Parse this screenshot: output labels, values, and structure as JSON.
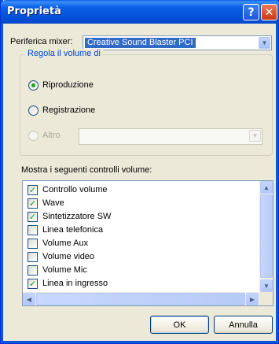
{
  "window": {
    "title": "Proprietà",
    "help_label": "?",
    "close_label": "✕"
  },
  "mixer": {
    "label": "Periferica mixer:",
    "selected": "Creative Sound Blaster PCI"
  },
  "volume_group": {
    "title": "Regola il volume di",
    "options": [
      {
        "label": "Riproduzione",
        "checked": true,
        "enabled": true
      },
      {
        "label": "Registrazione",
        "checked": false,
        "enabled": true
      },
      {
        "label": "Altro",
        "checked": false,
        "enabled": false
      }
    ],
    "altro_select_value": ""
  },
  "controls": {
    "label": "Mostra i seguenti controlli volume:",
    "items": [
      {
        "label": "Controllo volume",
        "checked": true
      },
      {
        "label": "Wave",
        "checked": true
      },
      {
        "label": "Sintetizzatore SW",
        "checked": true
      },
      {
        "label": "Linea telefonica",
        "checked": false
      },
      {
        "label": "Volume Aux",
        "checked": false
      },
      {
        "label": "Volume video",
        "checked": false
      },
      {
        "label": "Volume Mic",
        "checked": false
      },
      {
        "label": "Linea in ingresso",
        "checked": true
      }
    ]
  },
  "scroll_icons": {
    "up": "▲",
    "down": "▼",
    "left": "◀",
    "right": "▶"
  },
  "buttons": {
    "ok": "OK",
    "cancel": "Annulla"
  },
  "check_glyph": "✓",
  "colors": {
    "title_bar": "#0a5ef0",
    "window_bg": "#ece9d8",
    "accent": "#316ac5",
    "check": "#21a121",
    "group_title": "#0046d5"
  }
}
